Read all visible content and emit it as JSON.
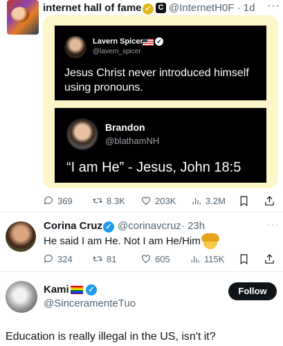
{
  "top_tweet": {
    "name": "internet hall of fame",
    "verified_badge": "gold-check",
    "affiliate_label": "C",
    "handle": "@InternetH0F",
    "time": "· 1d",
    "more": "···"
  },
  "quoted_image": {
    "panel1": {
      "name": "Lavern Spicer",
      "handle": "@lavern_spicer",
      "text": "Jesus Christ never introduced himself using pronouns."
    },
    "panel2": {
      "name": "Brandon",
      "handle": "@blathamNH",
      "text": "“I am He” - Jesus, John 18:5"
    }
  },
  "top_actions": {
    "replies": "369",
    "reposts": "8.3K",
    "likes": "203K",
    "views": "3.2M"
  },
  "reply1": {
    "name": "Corina Cruz",
    "handle": "@corinavcruz",
    "time": "· 23h",
    "more": "···",
    "text": "He said I am He. Not I am He/Him",
    "replies": "324",
    "reposts": "81",
    "likes": "605",
    "views": "115K"
  },
  "reply2": {
    "name": "Kami",
    "handle": "@SinceramenteTuo",
    "follow_label": "Follow",
    "text": "Education is really illegal in the US, isn't it?"
  },
  "colors": {
    "accent_blue": "#1d9bf0",
    "gold_badge": "#e2b719",
    "panel_bg": "#fdf6c8",
    "muted_text": "#536471"
  }
}
